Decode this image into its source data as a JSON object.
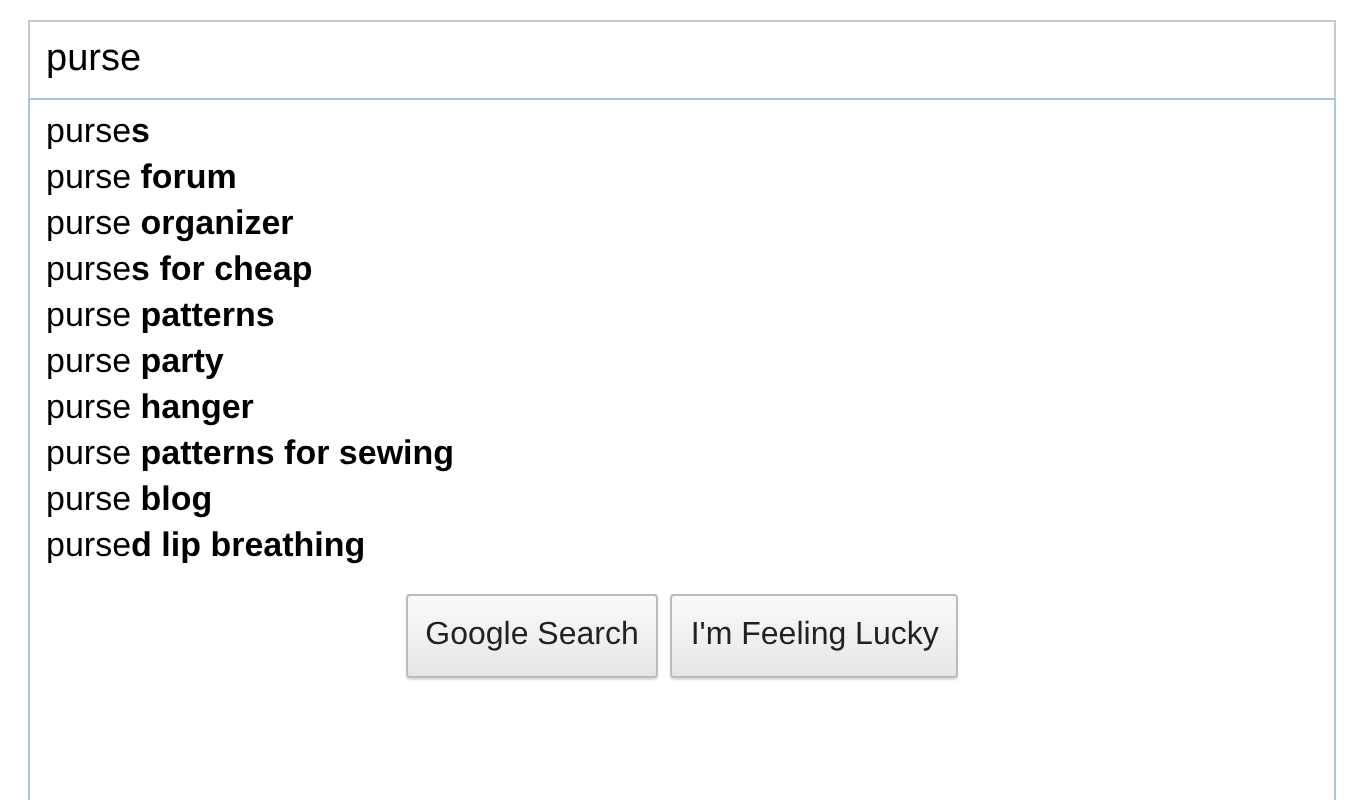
{
  "search": {
    "value": "purse"
  },
  "suggestions": [
    "purse**s**",
    "purse **forum**",
    "purse **organizer**",
    "purse**s for cheap**",
    "purse **patterns**",
    "purse **party**",
    "purse **hanger**",
    "purse **patterns for sewing**",
    "purse **blog**",
    "purse**d lip breathing**"
  ],
  "buttons": [
    "Google Search",
    "I'm Feeling Lucky"
  ]
}
